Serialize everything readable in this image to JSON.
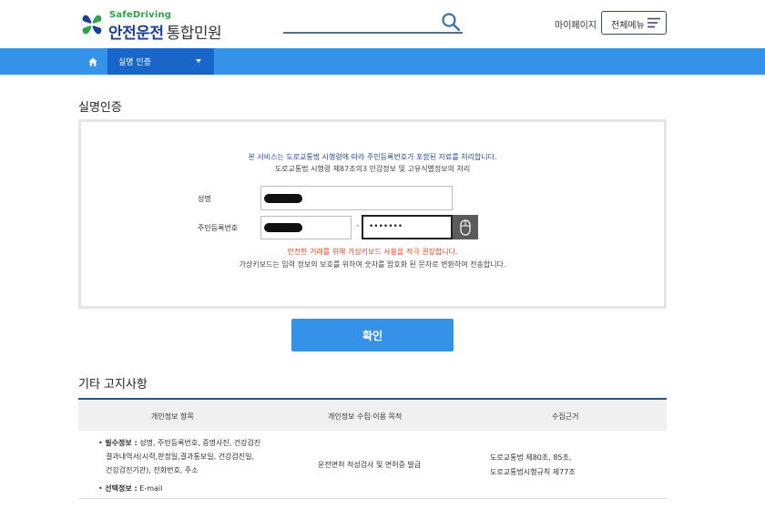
{
  "header": {
    "logo_sub": "SafeDriving",
    "logo_main": "안전운전",
    "logo_main_suffix": "통합민원",
    "search_placeholder": "",
    "mypage": "마이페이지",
    "all_menu": "전체메뉴"
  },
  "nav": {
    "home_icon": "home-icon",
    "current": "실명 인증"
  },
  "auth": {
    "title": "실명인증",
    "notice_1": "본 서비스는 도로교통법 시행령에 따라 주민등록번호가 포함된 자료를 처리합니다.",
    "notice_2": "도로교통법 시행령 제87조의3 민감정보 및 고유식별정보의 처리",
    "name_label": "성명",
    "rrn_label": "주민등록번호",
    "rrn_separator": "-",
    "rrn_back_value": "•••••••",
    "warning": "안전한 거래를 위해 가상키보드 사용을 적극 권장합니다.",
    "keypad_note": "가상키보드는 입력 정보의 보호를 위하여 숫자를 암호화 된 문자로 변환하여 전송합니다.",
    "confirm": "확인"
  },
  "other": {
    "title": "기타 고지사항",
    "columns": [
      "개인정보 항목",
      "개인정보 수집·이용 목적",
      "수집근거"
    ],
    "required_label": "필수정보 :",
    "required_line_1": " 성명, 주민등록번호, 증명사진, 건강검진",
    "required_line_2": "결과내역서(시력,판정일,결과통보일, 건강검진일,",
    "required_line_3": "건강검진기관), 전화번호, 주소",
    "optional_label": "선택정보 :",
    "optional_value": " E-mail",
    "purpose": "운전면허 적성검사 및 면허증 발급",
    "basis_1": "도로교통법 제80조, 85조,",
    "basis_2": "도로교통법시행규칙 제77조"
  },
  "colors": {
    "brand_blue": "#3592e9",
    "nav_active": "#1866c9",
    "logo_green": "#2ea24a",
    "logo_navy": "#1d3f8f",
    "warning_red": "#e14a2a"
  }
}
